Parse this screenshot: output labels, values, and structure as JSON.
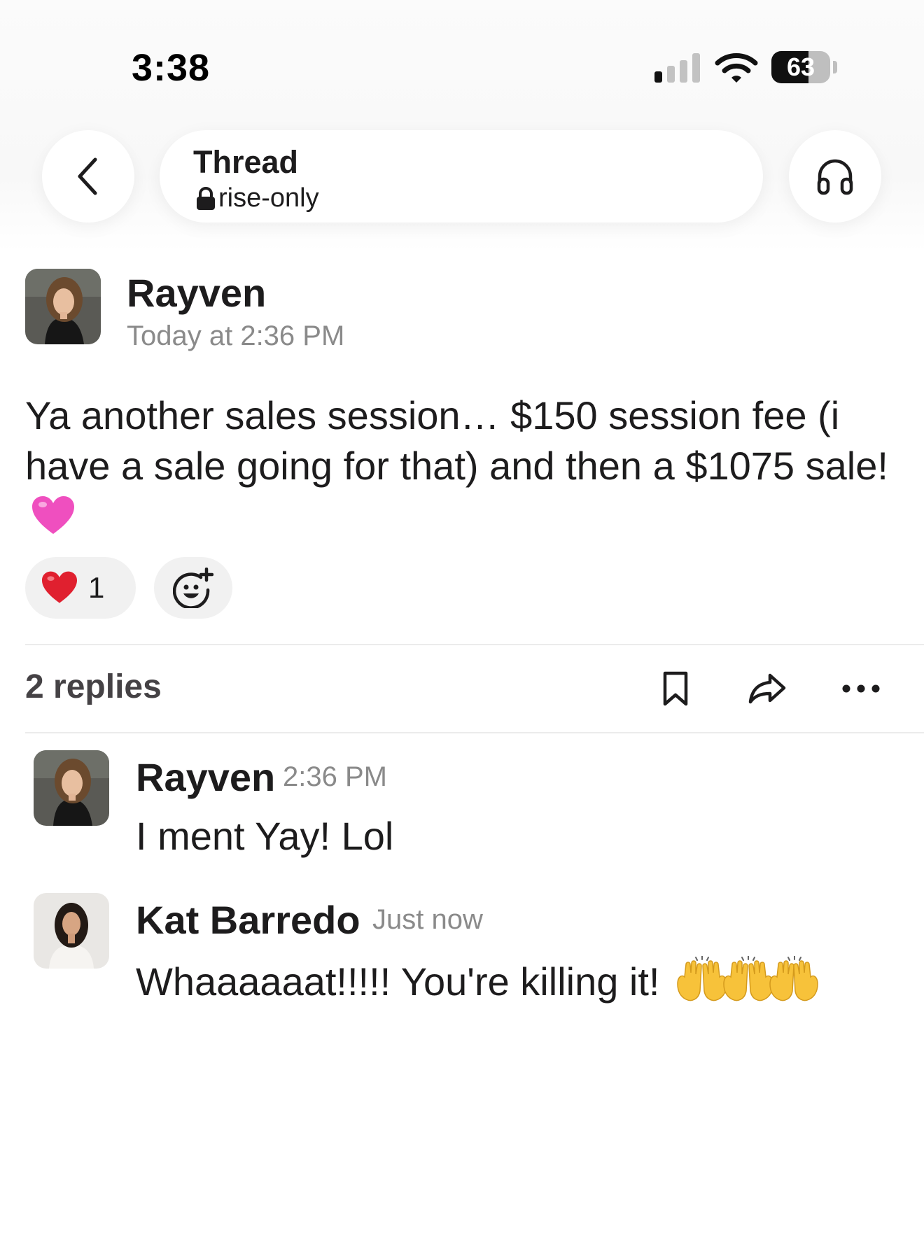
{
  "status_bar": {
    "time": "3:38",
    "battery_level": "63",
    "battery_fraction": 0.63,
    "signal_bars_active": 1,
    "signal_bars_total": 4
  },
  "header": {
    "title": "Thread",
    "channel": "rise-only",
    "channel_icon": "lock-icon",
    "back_icon": "chevron-left-icon",
    "huddle_icon": "headphones-icon"
  },
  "root_message": {
    "author": "Rayven",
    "timestamp": "Today at 2:36 PM",
    "text": "Ya another sales session… $150 session fee (i have a sale going for that) and then a $1075 sale!",
    "emoji": "pink-heart",
    "reactions": [
      {
        "emoji": "red-heart",
        "count": "1"
      }
    ],
    "add_reaction_icon": "add-reaction-icon"
  },
  "thread_bar": {
    "replies_label": "2 replies",
    "save_icon": "bookmark-icon",
    "share_icon": "share-arrow-icon",
    "more_icon": "more-horizontal-icon"
  },
  "replies": [
    {
      "author": "Rayven",
      "time": "2:36 PM",
      "text": "I ment Yay! Lol"
    },
    {
      "author": "Kat Barredo",
      "time": "Just now",
      "text": "Whaaaaaat!!!!! You're killing it!",
      "emoji": "raising-hands"
    }
  ],
  "colors": {
    "text_primary": "#1d1c1d",
    "text_secondary": "#8a8a8a",
    "pill_background": "#f1f1f1",
    "heart_red": "#e0202f",
    "heart_pink": "#ef4fbf",
    "raise_hands_yellow": "#f7c23a"
  }
}
